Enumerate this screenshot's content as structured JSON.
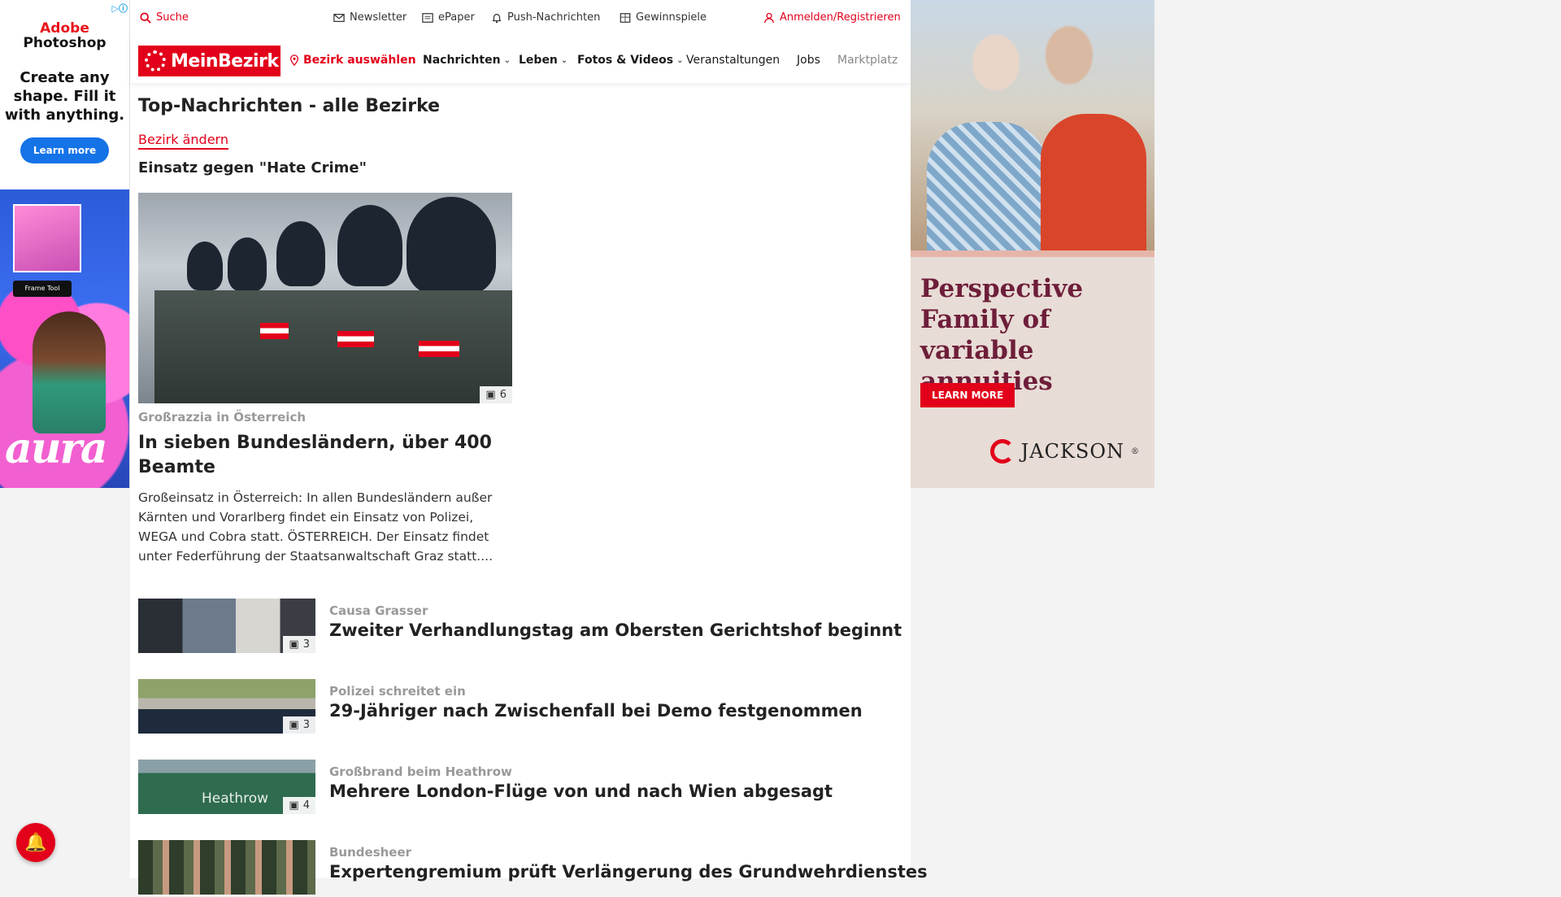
{
  "ad_left": {
    "brand_line1": "Adobe",
    "brand_line2": "Photoshop",
    "headline": "Create any shape. Fill it with anything.",
    "cta": "Learn more",
    "pill": "Frame Tool",
    "art_word": "aura",
    "adchoices_icon": "adchoices-icon"
  },
  "utility": {
    "search": "Suche",
    "newsletter": "Newsletter",
    "epaper": "ePaper",
    "push": "Push-Nachrichten",
    "contests": "Gewinnspiele",
    "login": "Anmelden/Registrieren"
  },
  "nav": {
    "logo": "MeinBezirk",
    "district_select": "Bezirk auswählen",
    "items": [
      "Nachrichten",
      "Leben",
      "Fotos & Videos",
      "Veranstaltungen",
      "Jobs",
      "Marktplatz"
    ]
  },
  "main": {
    "page_title": "Top-Nachrichten - alle Bezirke",
    "change_district": "Bezirk ändern",
    "topic": "Einsatz gegen \"Hate Crime\"",
    "lead": {
      "image_count": "6",
      "kicker": "Großrazzia in Österreich",
      "title": "In sieben Bundesländern, über 400 Beamte",
      "teaser": "Großeinsatz in Österreich: In allen Bundesländern außer Kärnten und Vorarlberg findet ein Einsatz von Polizei, WEGA und Cobra statt. ÖSTERREICH. Der Einsatz findet unter Federführung der Staatsanwaltschaft Graz statt...."
    },
    "articles": [
      {
        "kicker": "Causa Grasser",
        "title": "Zweiter Verhandlungstag am Obersten Gerichtshof beginnt",
        "image_count": "3"
      },
      {
        "kicker": "Polizei schreitet ein",
        "title": "29-Jähriger nach Zwischenfall bei Demo festgenommen",
        "image_count": "3"
      },
      {
        "kicker": "Großbrand beim Heathrow",
        "title": "Mehrere London-Flüge von und nach Wien abgesagt",
        "image_count": "4",
        "thumb_text": "Heathrow"
      },
      {
        "kicker": "Bundesheer",
        "title": "Expertengremium prüft Verlängerung des Grundwehrdienstes",
        "image_count": ""
      }
    ]
  },
  "ad_right": {
    "copy": "Perspective Family of variable annuities",
    "cta": "LEARN MORE",
    "brand": "JACKSON",
    "brand_mark": "®"
  },
  "colors": {
    "accent": "#e2001a",
    "ad_copy": "#6e1e3a"
  }
}
